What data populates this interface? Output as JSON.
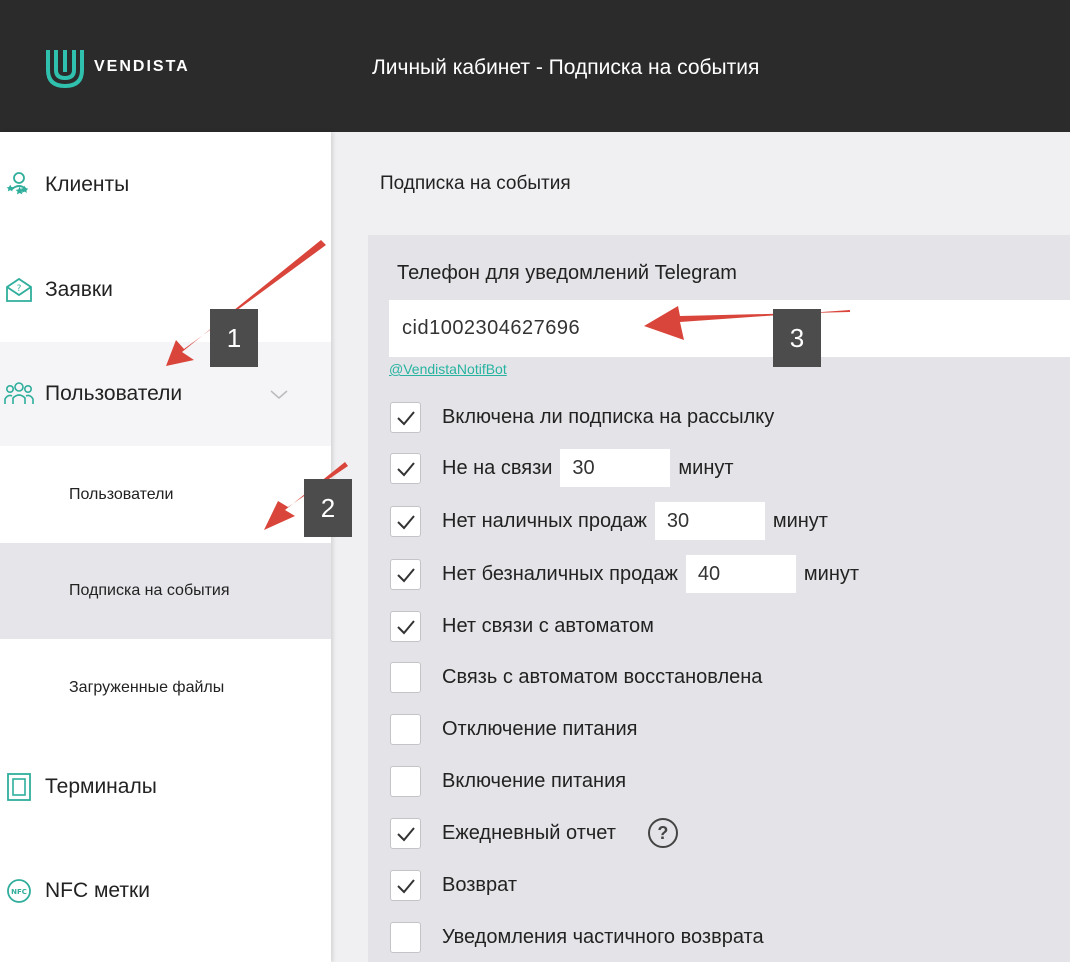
{
  "header": {
    "brand": "VENDISTA",
    "title": "Личный кабинет - Подписка на события"
  },
  "sidebar": {
    "items": [
      {
        "label": "Клиенты",
        "icon": "clients-icon"
      },
      {
        "label": "Заявки",
        "icon": "envelope-question-icon"
      },
      {
        "label": "Пользователи",
        "icon": "users-icon"
      },
      {
        "label": "Терминалы",
        "icon": "terminal-icon"
      },
      {
        "label": "NFC метки",
        "icon": "nfc-icon"
      }
    ],
    "subitems": [
      {
        "label": "Пользователи"
      },
      {
        "label": "Подписка на события"
      },
      {
        "label": "Загруженные файлы"
      }
    ]
  },
  "main": {
    "title": "Подписка на события",
    "phone_label": "Телефон для уведомлений Telegram",
    "phone_value": "cid1002304627696",
    "bot_link": "@VendistaNotifBot",
    "options": [
      {
        "label": "Включена ли подписка на рассылку",
        "checked": true
      },
      {
        "label": "Не на связи",
        "checked": true,
        "value": "30",
        "unit": "минут"
      },
      {
        "label": "Нет наличных продаж",
        "checked": true,
        "value": "30",
        "unit": "минут"
      },
      {
        "label": "Нет безналичных продаж",
        "checked": true,
        "value": "40",
        "unit": "минут"
      },
      {
        "label": "Нет связи с автоматом",
        "checked": true
      },
      {
        "label": "Связь с автоматом восстановлена",
        "checked": false
      },
      {
        "label": "Отключение питания",
        "checked": false
      },
      {
        "label": "Включение питания",
        "checked": false
      },
      {
        "label": "Ежедневный отчет",
        "checked": true,
        "help": "?"
      },
      {
        "label": "Возврат",
        "checked": true
      },
      {
        "label": "Уведомления частичного возврата",
        "checked": false
      }
    ]
  },
  "annotations": {
    "badges": [
      "1",
      "2",
      "3"
    ],
    "arrow_color": "#d9453a"
  },
  "colors": {
    "header_bg": "#2b2b2b",
    "accent": "#26b3a0",
    "panel_bg": "#e4e4e8"
  }
}
